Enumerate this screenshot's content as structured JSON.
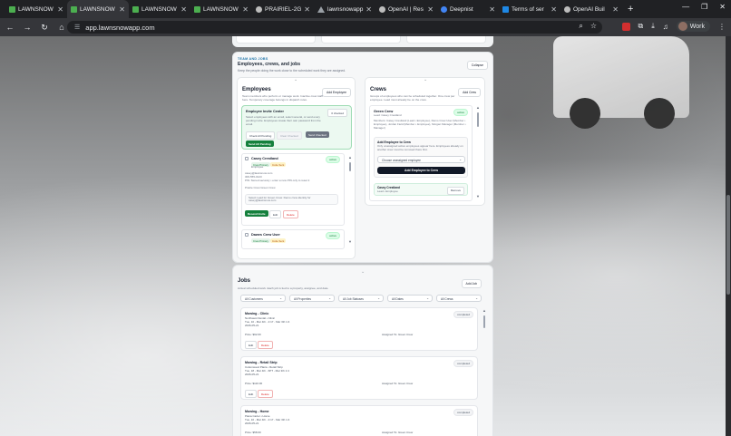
{
  "browser": {
    "tabs": [
      {
        "title": "LAWNSNOW",
        "icon": "lawnsnow-favicon-icon",
        "active": false
      },
      {
        "title": "LAWNSNOW",
        "icon": "lawnsnow-favicon-icon",
        "active": true
      },
      {
        "title": "LAWNSNOW",
        "icon": "lawnsnow-favicon-icon",
        "active": false
      },
      {
        "title": "LAWNSNOW",
        "icon": "lawnsnow-favicon-icon",
        "active": false
      },
      {
        "title": "PRAIRIEL-2G",
        "icon": "globe-icon",
        "active": false
      },
      {
        "title": "lawnsnowapp",
        "icon": "triangle-icon",
        "active": false
      },
      {
        "title": "OpenAI | Res",
        "icon": "openai-icon",
        "active": false
      },
      {
        "title": "Deepnist",
        "icon": "deepnist-icon",
        "active": false
      },
      {
        "title": "Terms of ser",
        "icon": "doc-icon",
        "active": false
      },
      {
        "title": "OpenAI Buil",
        "icon": "openai-icon",
        "active": false
      }
    ],
    "url": "app.lawnsnowapp.com",
    "profile": "Work"
  },
  "team": {
    "tag": "TEAM AND JOBS",
    "title": "Employees, crews, and jobs",
    "subtitle": "Keep the people doing the work close to the scheduled work they are assigned.",
    "collapse_label": "Collapse",
    "chevron": "⌄",
    "employees": {
      "title": "Employees",
      "add_label": "Add Employee",
      "desc": "Team members who perform or manage work. Inactive crew staff here. Temporary coverage belongs in dispatch rules.",
      "invite": {
        "title": "Employee Invite Center",
        "checked_label": "0 checked",
        "desc": "Select employees with an email, select several, or send every pending invite. Employees create their own password from the email.",
        "check_pending": "Check All Pending",
        "clear_checked": "Clear Checked",
        "send_checked": "Send Checked",
        "send_all": "Send All Pending"
      },
      "cards": [
        {
          "name": "Casey Crestland",
          "status": "active",
          "chips": [
            "Crew Primary",
            "Invite Sent"
          ],
          "role": "Employee",
          "email": "casey@lawnsnow.com",
          "phone": "306-555-0123",
          "note": "PIN: Stored securely • enter a new PIN only to reset it",
          "crew": "Prairie Crew Green Crew",
          "lead_note": "Select Lead for Green Crew. Demo crew identity for casey@lawnsnow.com",
          "resend": "Resend Invite",
          "edit": "Edit",
          "delete": "Delete"
        },
        {
          "name": "Dawes Crew User",
          "status": "active",
          "chips": [
            "Crew Primary",
            "Invite Sent"
          ]
        }
      ]
    },
    "crews": {
      "title": "Crews",
      "add_label": "Add Crew",
      "desc": "Groups of employees who can be scheduled together. One crew per employee. Lead must already be on the crew.",
      "crew": {
        "name": "Green Crew",
        "status": "active",
        "lead": "Lead: Casey Crestland",
        "members": "Members: Casey Crestland (Lead • Employee), Demo Crew User (Member • Employee), Jordan Field (Member • Employee), Morgan Manager (Member • Manager)",
        "add_title": "Add Employee to Crew",
        "add_desc": "Only unassigned active employees appear here. Employees already on another crew must be removed there first.",
        "select_placeholder": "Choose unassigned employee",
        "add_button": "Add Employee to Crew",
        "member_name": "Casey Crestland",
        "member_role": "Lead • Employee",
        "remove": "Remove"
      }
    }
  },
  "jobs": {
    "title": "Jobs",
    "add_label": "Add Job",
    "desc": "Actual scheduled work. Each job is tied to a property, assignee, and date.",
    "filters": [
      "All Customers",
      "All Properties",
      "All Job Statuses",
      "All Dates",
      "All Crews"
    ],
    "list": [
      {
        "title": "Mowing - Clinic",
        "place": "Northwest Dental • Clinic",
        "time": "Tue, 10 - Mar 4th - 2:17 - Mar 3th 1:4",
        "date": "2026-05-21",
        "price": "Price: $92.00",
        "assigned": "Assigned To: Green Crew",
        "status": "completed",
        "edit": "Edit",
        "delete": "Delete"
      },
      {
        "title": "Mowing - Retail Strip",
        "place": "Cottonwood Plaza • Retail Strip",
        "time": "Tue, 18 - Mar 4th - 6PT - Mar 3th 1:4",
        "date": "2026-05-21",
        "price": "Price: $110.00",
        "assigned": "Assigned To: Green Crew",
        "status": "completed",
        "edit": "Edit",
        "delete": "Delete"
      },
      {
        "title": "Mowing - Home",
        "place": "Piana Carter • Home",
        "time": "Tue, 10 - Mar 4th - 2:17 - Mar 3th 1:4",
        "date": "2026-05-21",
        "price": "Price: $58.00",
        "assigned": "Assigned To: Green Crew",
        "status": "completed"
      }
    ]
  }
}
